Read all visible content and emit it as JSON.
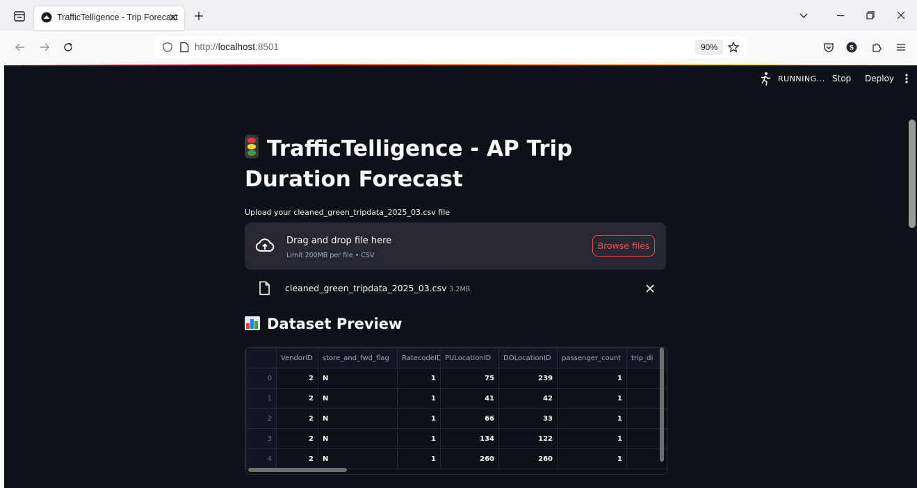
{
  "browser": {
    "tab_title": "TrafficTelligence - Trip Forecast",
    "url_prefix": "http://",
    "url_host": "localhost",
    "url_port": ":8501",
    "zoom": "90%"
  },
  "app_header": {
    "status": "RUNNING...",
    "stop_label": "Stop",
    "deploy_label": "Deploy"
  },
  "page": {
    "title": "TrafficTelligence - AP Trip Duration Forecast",
    "title_emoji": "traffic-light-icon"
  },
  "uploader": {
    "label": "Upload your cleaned_green_tripdata_2025_03.csv file",
    "drop_title": "Drag and drop file here",
    "drop_limit": "Limit 200MB per file • CSV",
    "browse_label": "Browse files",
    "file_name": "cleaned_green_tripdata_2025_03.csv",
    "file_size": "3.2MB"
  },
  "preview": {
    "heading": "Dataset Preview",
    "heading_emoji": "bar-chart-icon",
    "columns": [
      "",
      "VendorID",
      "store_and_fwd_flag",
      "RatecodeID",
      "PULocationID",
      "DOLocationID",
      "passenger_count",
      "trip_di"
    ],
    "rows": [
      [
        "0",
        "2",
        "N",
        "1",
        "75",
        "239",
        "1",
        ""
      ],
      [
        "1",
        "2",
        "N",
        "1",
        "41",
        "42",
        "1",
        ""
      ],
      [
        "2",
        "2",
        "N",
        "1",
        "66",
        "33",
        "1",
        ""
      ],
      [
        "3",
        "2",
        "N",
        "1",
        "134",
        "122",
        "1",
        ""
      ],
      [
        "4",
        "2",
        "N",
        "1",
        "260",
        "260",
        "1",
        ""
      ]
    ]
  },
  "colors": {
    "accent": "#ff4b4b",
    "app_background": "#0e1117",
    "dropzone": "#262730"
  }
}
